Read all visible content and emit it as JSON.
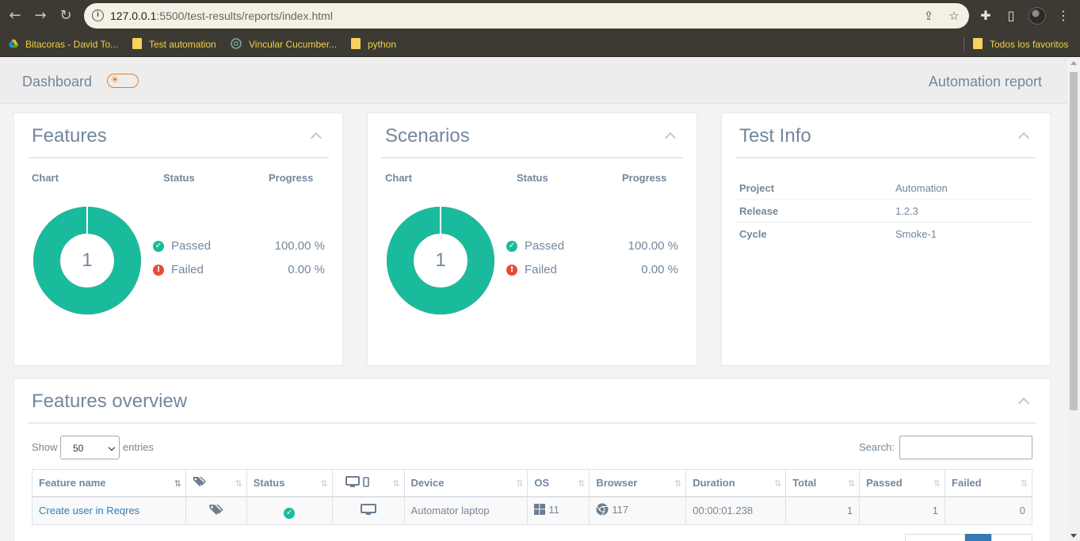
{
  "browser": {
    "url_host": "127.0.0.1",
    "url_path": ":5500/test-results/reports/index.html",
    "bookmarks": [
      {
        "label": "Bitacoras - David To...",
        "icon": "drive-icon"
      },
      {
        "label": "Test automation",
        "icon": "folder-icon"
      },
      {
        "label": "Vincular Cucumber...",
        "icon": "openai-icon"
      },
      {
        "label": "python",
        "icon": "folder-icon"
      }
    ],
    "all_bookmarks": "Todos los favoritos"
  },
  "header": {
    "title": "Dashboard",
    "report_title": "Automation report"
  },
  "features_panel": {
    "title": "Features",
    "col_chart": "Chart",
    "col_status": "Status",
    "col_progress": "Progress",
    "total": "1",
    "passed_label": "Passed",
    "passed_pct": "100.00 %",
    "failed_label": "Failed",
    "failed_pct": "0.00 %",
    "passed_fraction": 1.0
  },
  "scenarios_panel": {
    "title": "Scenarios",
    "col_chart": "Chart",
    "col_status": "Status",
    "col_progress": "Progress",
    "total": "1",
    "passed_label": "Passed",
    "passed_pct": "100.00 %",
    "failed_label": "Failed",
    "failed_pct": "0.00 %",
    "passed_fraction": 1.0
  },
  "test_info": {
    "title": "Test Info",
    "rows": [
      {
        "key": "Project",
        "value": "Automation"
      },
      {
        "key": "Release",
        "value": "1.2.3"
      },
      {
        "key": "Cycle",
        "value": "Smoke-1"
      }
    ]
  },
  "overview": {
    "title": "Features overview",
    "show_label": "Show",
    "entries_value": "50",
    "entries_label": "entries",
    "search_label": "Search:",
    "columns": [
      "Feature name",
      "",
      "Status",
      "",
      "Device",
      "OS",
      "Browser",
      "Duration",
      "Total",
      "Passed",
      "Failed"
    ],
    "row": {
      "feature": "Create user in Reqres",
      "device": "Automator laptop",
      "os_version": "11",
      "browser_version": "117",
      "duration": "00:00:01.238",
      "total": "1",
      "passed": "1",
      "failed": "0"
    }
  },
  "colors": {
    "passed": "#1abb9c",
    "failed": "#e74c3c",
    "text": "#73879c",
    "accent": "#e87b1c"
  }
}
